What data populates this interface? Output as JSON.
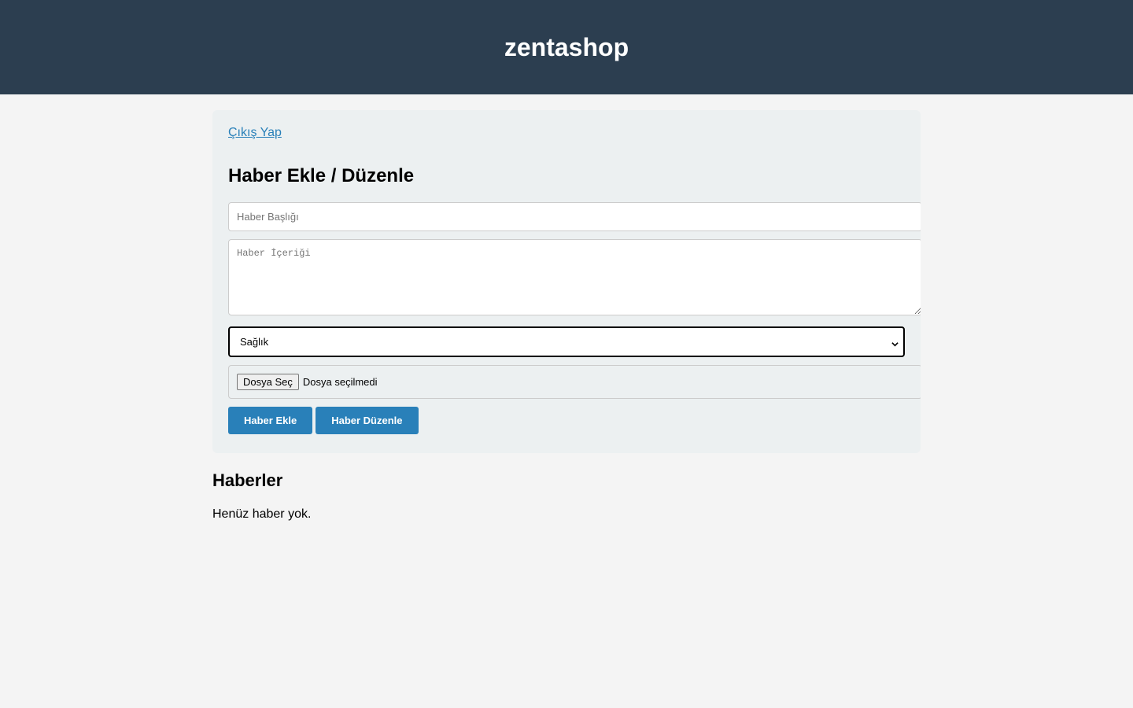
{
  "header": {
    "site_title": "zentashop"
  },
  "admin": {
    "logout_label": "Çıkış Yap",
    "form_title": "Haber Ekle / Düzenle",
    "title_placeholder": "Haber Başlığı",
    "content_placeholder": "Haber İçeriği",
    "category_selected": "Sağlık",
    "file_button_label": "Dosya Seç",
    "file_status": "Dosya seçilmedi",
    "add_button_label": "Haber Ekle",
    "edit_button_label": "Haber Düzenle"
  },
  "news": {
    "heading": "Haberler",
    "empty_message": "Henüz haber yok."
  },
  "colors": {
    "header_bg": "#2c3e50",
    "accent": "#2980b9",
    "panel_bg": "#ecf0f1",
    "page_bg": "#f4f4f4"
  }
}
